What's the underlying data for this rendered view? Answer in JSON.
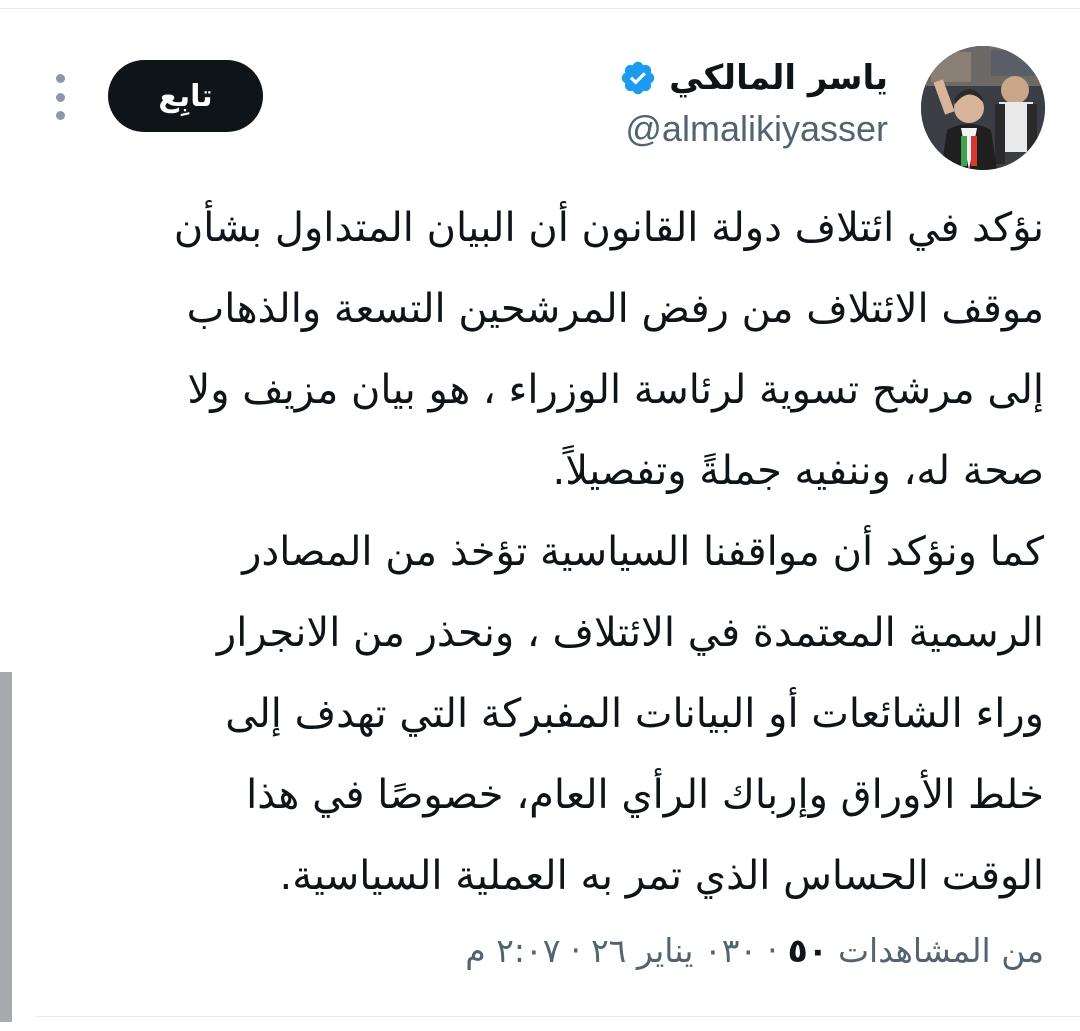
{
  "author": {
    "display_name": "ياسر المالكي",
    "handle": "@almalikiyasser",
    "verified_icon": "verified-badge-icon",
    "verified_color": "#1d9bf0"
  },
  "follow_button": {
    "label": "تابِع"
  },
  "more_icon": "vertical-ellipsis-icon",
  "tweet": {
    "lines": [
      "نؤكد في ائتلاف دولة القانون أن البيان المتداول بشأن",
      "موقف الائتلاف من رفض المرشحين التسعة والذهاب",
      "إلى مرشح تسوية لرئاسة الوزراء ، هو بيان مزيف ولا",
      "صحة له، وننفيه جملةً وتفصيلاً.",
      "كما ونؤكد أن مواقفنا السياسية تؤخذ من المصادر",
      "الرسمية المعتمدة في الائتلاف ، ونحذر من الانجرار",
      "وراء الشائعات أو البيانات المفبركة التي تهدف إلى",
      "خلط الأوراق وإرباك الرأي العام، خصوصًا في هذا",
      "الوقت الحساس الذي تمر به العملية السياسية."
    ]
  },
  "meta": {
    "time": "٢:٠٧ م",
    "separator": "·",
    "date": "٠٣٠ يناير ٢٦",
    "views_count": "٥٠",
    "views_label": "من المشاهدات"
  },
  "colors": {
    "text_primary": "#0f1419",
    "text_secondary": "#536471",
    "button_bg": "#0f1419",
    "divider": "#e6e9ec"
  }
}
